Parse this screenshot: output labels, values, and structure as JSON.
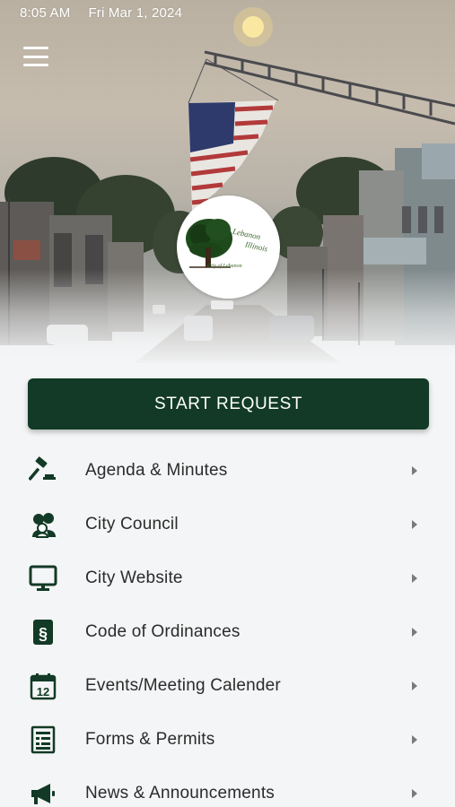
{
  "status_bar": {
    "time": "8:05 AM",
    "date": "Fri Mar 1, 2024"
  },
  "logo": {
    "line1": "Lebanon",
    "line2": "Illinois",
    "line3": "City of Lebanon"
  },
  "cta": {
    "label": "START REQUEST"
  },
  "menu": [
    {
      "label": "Agenda & Minutes",
      "icon": "gavel-icon"
    },
    {
      "label": "City Council",
      "icon": "people-group-icon"
    },
    {
      "label": "City Website",
      "icon": "monitor-icon"
    },
    {
      "label": "Code of Ordinances",
      "icon": "section-book-icon"
    },
    {
      "label": "Events/Meeting Calender",
      "icon": "calendar-icon"
    },
    {
      "label": "Forms & Permits",
      "icon": "form-list-icon"
    },
    {
      "label": "News & Announcements",
      "icon": "megaphone-icon"
    }
  ],
  "colors": {
    "accent": "#123a26",
    "icon": "#123a26",
    "background": "#f4f5f6"
  }
}
